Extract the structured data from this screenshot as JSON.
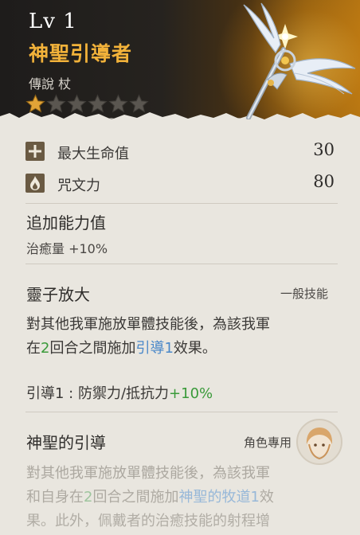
{
  "item": {
    "level": "Lv 1",
    "name": "神聖引導者",
    "subtype": "傳說 杖",
    "stars_filled": 1,
    "stars_total": 6
  },
  "stats": [
    {
      "label": "最大生命值",
      "value": "30",
      "icon": "cross-health-icon"
    },
    {
      "label": "咒文力",
      "value": "80",
      "icon": "magic-flame-icon"
    }
  ],
  "bonus": {
    "title": "追加能力值",
    "text": "治癒量 +10%"
  },
  "skill1": {
    "name": "靈子放大",
    "type": "一般技能",
    "desc_line1": "對其他我軍施放單體技能後，為該我軍",
    "desc_l2_a": "在",
    "desc_l2_turns": "2",
    "desc_l2_b": "回合之間施加",
    "desc_l2_buff": "引導1",
    "desc_l2_c": "效果。",
    "effect_label": "引導1 : 防禦力/抵抗力",
    "effect_value": "+10%"
  },
  "skill2": {
    "name": "神聖的引導",
    "type": "角色專用",
    "desc_line1": "對其他我軍施放單體技能後，為該我軍",
    "desc_l2_a": "和自身在",
    "desc_l2_turns": "2",
    "desc_l2_b": "回合之間施加",
    "desc_l2_buff": "神聖的牧道1",
    "desc_l2_c": "效",
    "desc_line3": "果。此外，佩戴者的治癒技能的射程增"
  },
  "colors": {
    "name_gold": "#f2b23a",
    "star_filled": "#e2a437",
    "star_empty": "#5a5650",
    "highlight_green": "#3a9a3a",
    "highlight_blue": "#4a88c9"
  }
}
